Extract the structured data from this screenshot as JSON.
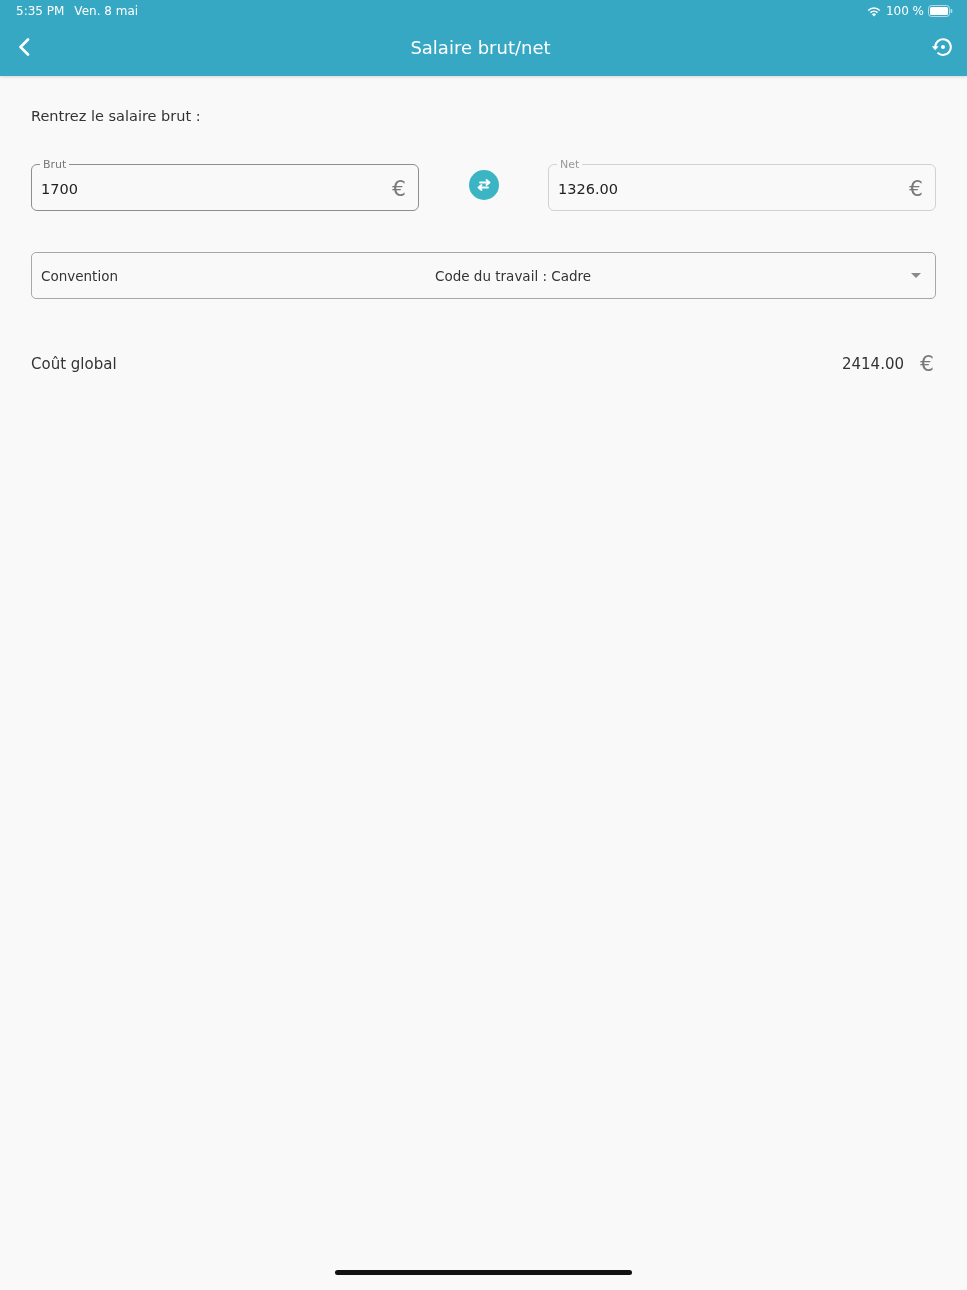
{
  "status_bar": {
    "time": "5:35 PM",
    "date": "Ven. 8 mai",
    "battery_text": "100 %"
  },
  "header": {
    "title": "Salaire brut/net"
  },
  "prompt": "Rentrez le salaire brut :",
  "amount_fields": [
    {
      "label": "Brut",
      "value": "1700",
      "currency": "€",
      "focused": true
    },
    {
      "label": "Net",
      "value": "1326.00",
      "currency": "€",
      "focused": false
    }
  ],
  "convention": {
    "label": "Convention",
    "value": "Code du travail : Cadre"
  },
  "total": {
    "label": "Coût global",
    "value": "2414.00",
    "currency": "€"
  }
}
